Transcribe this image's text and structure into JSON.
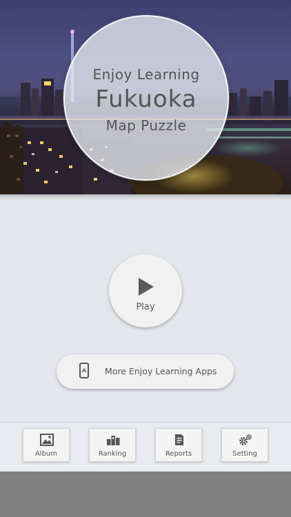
{
  "hero": {
    "title_line1": "Enjoy Learning",
    "title_line2": "Fukuoka",
    "title_line3": "Map Puzzle"
  },
  "play": {
    "label": "Play",
    "icon": "play-icon"
  },
  "more_apps": {
    "label": "More Enjoy Learning Apps",
    "icon": "smartphone-icon"
  },
  "toolbar": {
    "items": [
      {
        "label": "Album",
        "icon": "picture-icon"
      },
      {
        "label": "Ranking",
        "icon": "ranking-icon"
      },
      {
        "label": "Reports",
        "icon": "document-icon"
      },
      {
        "label": "Setting",
        "icon": "gears-icon"
      }
    ]
  },
  "colors": {
    "background": "#e3e7ec",
    "button": "#f1f1f1",
    "text": "#555555",
    "bottom_bar": "#808080"
  }
}
